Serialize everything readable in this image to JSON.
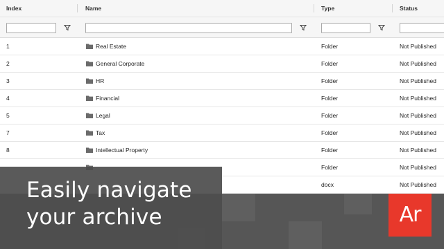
{
  "columns": [
    "Index",
    "Name",
    "Type",
    "Status"
  ],
  "filters": {
    "index": "",
    "name": "",
    "type": "",
    "status": ""
  },
  "rows": [
    {
      "index": "1",
      "name": "Real Estate",
      "type": "Folder",
      "status": "Not Published"
    },
    {
      "index": "2",
      "name": "General Corporate",
      "type": "Folder",
      "status": "Not Published"
    },
    {
      "index": "3",
      "name": "HR",
      "type": "Folder",
      "status": "Not Published"
    },
    {
      "index": "4",
      "name": "Financial",
      "type": "Folder",
      "status": "Not Published"
    },
    {
      "index": "5",
      "name": "Legal",
      "type": "Folder",
      "status": "Not Published"
    },
    {
      "index": "7",
      "name": "Tax",
      "type": "Folder",
      "status": "Not Published"
    },
    {
      "index": "8",
      "name": "Intellectual Property",
      "type": "Folder",
      "status": "Not Published"
    },
    {
      "index": "",
      "name": "",
      "type": "Folder",
      "status": "Not Published"
    },
    {
      "index": "",
      "name": "",
      "type": "docx",
      "status": "Not Published"
    }
  ],
  "banner": {
    "line1": "Easily navigate",
    "line2": "your archive"
  },
  "logo": {
    "text": "Ar"
  },
  "colors": {
    "logo_bg": "#e8382b",
    "banner_bg": "#4e4e4e",
    "header_bg": "#f6f6f6",
    "folder_icon": "#6b6b6b"
  },
  "icons": {
    "filter": "funnel-icon",
    "folder": "folder-icon"
  }
}
